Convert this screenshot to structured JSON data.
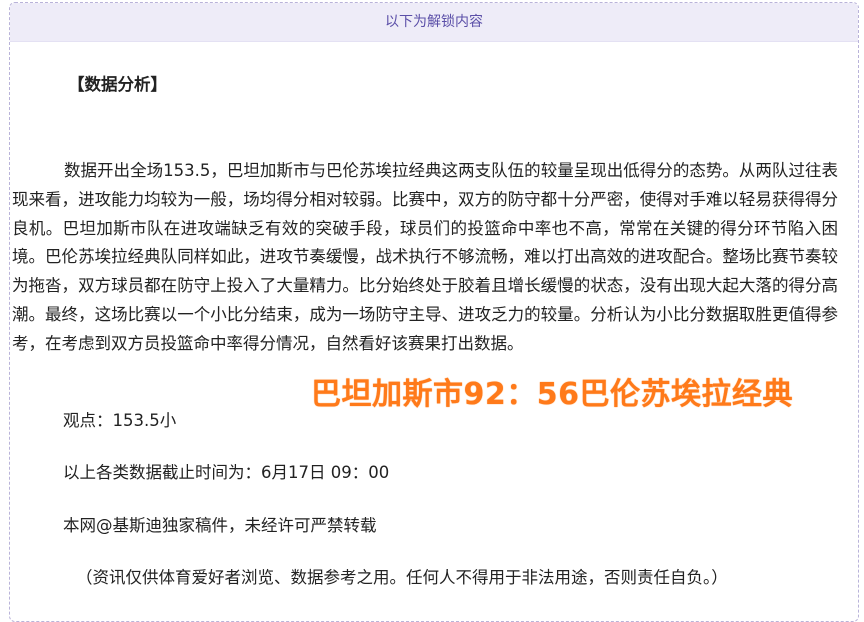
{
  "banner": {
    "text": "以下为解锁内容"
  },
  "article": {
    "section_title": "【数据分析】",
    "paragraph": "数据开出全场153.5，巴坦加斯市与巴伦苏埃拉经典这两支队伍的较量呈现出低得分的态势。从两队过往表现来看，进攻能力均较为一般，场均得分相对较弱。比赛中，双方的防守都十分严密，使得对手难以轻易获得得分良机。巴坦加斯市队在进攻端缺乏有效的突破手段，球员们的投篮命中率也不高，常常在关键的得分环节陷入困境。巴伦苏埃拉经典队同样如此，进攻节奏缓慢，战术执行不够流畅，难以打出高效的进攻配合。整场比赛节奏较为拖沓，双方球员都在防守上投入了大量精力。比分始终处于胶着且增长缓慢的状态，没有出现大起大落的得分高潮。最终，这场比赛以一个小比分结束，成为一场防守主导、进攻乏力的较量。分析认为小比分数据取胜更值得参考，在考虑到双方员投篮命中率得分情况，自然看好该赛果打出数据。",
    "score_overlay": "巴坦加斯市92：56巴伦苏埃拉经典",
    "viewpoint": "观点：153.5小",
    "cutoff": "以上各类数据截止时间为：6月17日 09：00",
    "copyright": "本网@基斯迪独家稿件，未经许可严禁转载",
    "disclaimer": "（资讯仅供体育爱好者浏览、数据参考之用。任何人不得用于非法用途，否则责任自负。）"
  },
  "colors": {
    "banner_bg": "#eeecf8",
    "banner_text": "#5b4fa8",
    "border": "#b9b3d9",
    "overlay": "#ff7a1a"
  }
}
